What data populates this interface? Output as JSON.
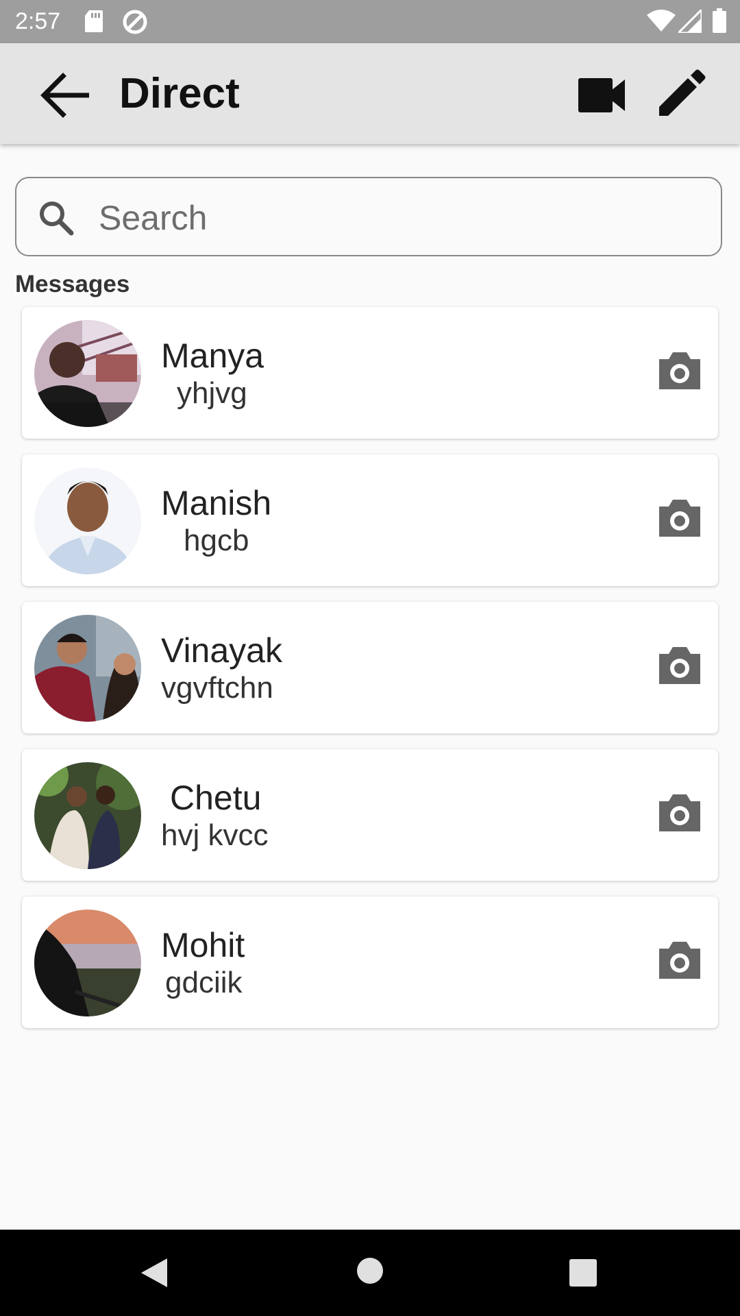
{
  "status_bar": {
    "time": "2:57",
    "icons": [
      "sd-card-icon",
      "sync-icon",
      "wifi-icon",
      "signal-icon",
      "battery-icon"
    ]
  },
  "app_bar": {
    "title": "Direct",
    "back_icon": "arrow-back-icon",
    "video_icon": "videocam-icon",
    "edit_icon": "pencil-icon"
  },
  "search": {
    "placeholder": "Search",
    "value": ""
  },
  "messages": {
    "section_label": "Messages",
    "items": [
      {
        "name": "Manya",
        "preview": "yhjvg"
      },
      {
        "name": "Manish",
        "preview": "hgcb"
      },
      {
        "name": "Vinayak",
        "preview": "vgvftchn"
      },
      {
        "name": "Chetu",
        "preview": "hvj kvcc"
      },
      {
        "name": "Mohit",
        "preview": "gdciik"
      }
    ]
  },
  "nav_bar": {
    "icons": [
      "back-triangle-icon",
      "home-circle-icon",
      "recents-square-icon"
    ]
  },
  "colors": {
    "status_bar": "#9e9e9e",
    "app_bar": "#e4e4e4",
    "background": "#fafafa",
    "icon_grey": "#666666",
    "nav_bar": "#000000"
  }
}
